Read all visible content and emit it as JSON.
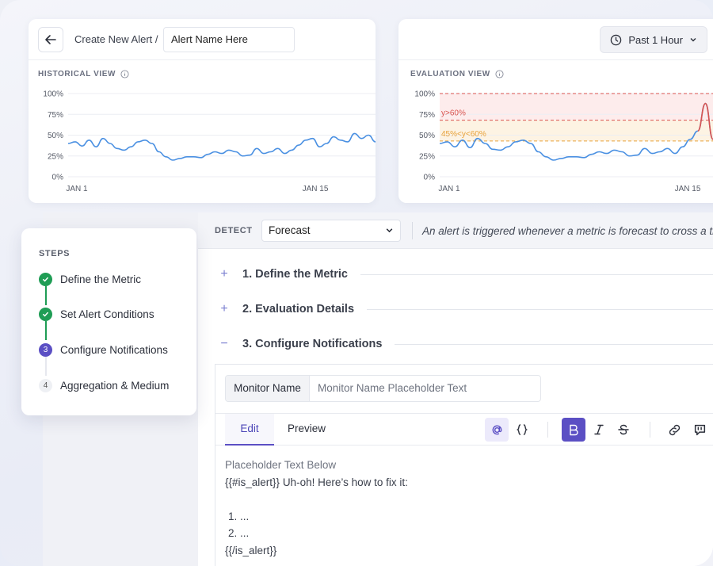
{
  "header": {
    "breadcrumb": "Create New Alert /",
    "alert_name_value": "Alert Name Here",
    "time_range": "Past 1 Hour"
  },
  "historical": {
    "label": "HISTORICAL VIEW",
    "y_ticks": [
      "100%",
      "75%",
      "50%",
      "25%",
      "0%"
    ],
    "x_ticks": [
      "JAN 1",
      "JAN 15"
    ]
  },
  "evaluation": {
    "label": "EVALUATION VIEW",
    "y_ticks": [
      "100%",
      "75%",
      "50%",
      "25%",
      "0%"
    ],
    "x_ticks": [
      "JAN 1",
      "JAN 15"
    ],
    "critical_label": "y>60%",
    "warning_label": "45%<y<60%"
  },
  "colors": {
    "line": "#4a90e2",
    "critical": "#d9534f",
    "warning": "#e8a23a",
    "accent": "#5b4fc4",
    "done": "#1f9d55"
  },
  "steps": {
    "title": "STEPS",
    "items": [
      {
        "label": "Define the Metric",
        "state": "done"
      },
      {
        "label": "Set Alert Conditions",
        "state": "done"
      },
      {
        "label": "Configure Notifications",
        "state": "active",
        "num": "3"
      },
      {
        "label": "Aggregation & Medium",
        "state": "todo",
        "num": "4"
      }
    ]
  },
  "detect": {
    "label": "DETECT",
    "selected": "Forecast",
    "description": "An alert is triggered whenever a metric is forecast to cross a threshold"
  },
  "sections": [
    {
      "sign": "+",
      "title": "1. Define the Metric"
    },
    {
      "sign": "+",
      "title": "2. Evaluation Details"
    },
    {
      "sign": "−",
      "title": "3. Configure Notifications"
    }
  ],
  "editor": {
    "monitor_label": "Monitor Name",
    "monitor_placeholder": "Monitor Name Placeholder Text",
    "tab_edit": "Edit",
    "tab_preview": "Preview",
    "lines": {
      "l1": "Placeholder Text Below",
      "l2": "{{#is_alert}} Uh-oh! Here’s how to fix it:",
      "l3": "1. ...",
      "l4": "2. ...",
      "l5": "{{/is_alert}}"
    }
  },
  "chart_data": [
    {
      "type": "line",
      "title": "HISTORICAL VIEW",
      "x_ticks": [
        "JAN 1",
        "JAN 15"
      ],
      "ylim": [
        0,
        100
      ],
      "y_ticks": [
        0,
        25,
        50,
        75,
        100
      ],
      "series": [
        {
          "values": [
            40,
            42,
            37,
            44,
            36,
            46,
            40,
            34,
            32,
            36,
            42,
            44,
            40,
            30,
            24,
            20,
            22,
            24,
            24,
            23,
            27,
            30,
            28,
            32,
            30,
            25,
            26,
            34,
            28,
            30,
            34,
            28,
            32,
            38,
            44,
            46,
            36,
            40,
            48,
            44,
            42,
            52,
            46,
            50,
            42
          ]
        }
      ]
    },
    {
      "type": "line",
      "title": "EVALUATION VIEW",
      "x_ticks": [
        "JAN 1",
        "JAN 15"
      ],
      "ylim": [
        0,
        100
      ],
      "y_ticks": [
        0,
        25,
        50,
        75,
        100
      ],
      "thresholds": [
        {
          "label": "y>60%",
          "value": 68
        },
        {
          "label": "45%<y<60%",
          "value": 43
        }
      ],
      "series": [
        {
          "values": [
            40,
            42,
            36,
            44,
            35,
            46,
            40,
            33,
            32,
            36,
            42,
            44,
            40,
            30,
            24,
            20,
            22,
            24,
            24,
            23,
            27,
            30,
            28,
            32,
            30,
            25,
            26,
            34,
            28,
            30,
            34,
            28,
            36,
            45,
            55,
            88,
            45
          ]
        }
      ]
    }
  ]
}
